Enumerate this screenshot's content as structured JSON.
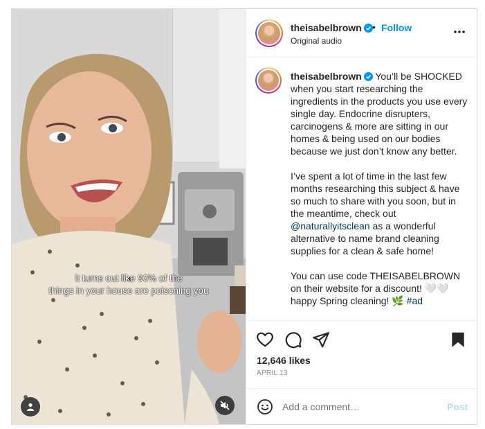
{
  "post": {
    "username": "theisabelbrown",
    "separator": "•",
    "follow_label": "Follow",
    "audio_label": "Original audio",
    "caption": {
      "username": "theisabelbrown",
      "paragraph1": "You’ll be SHOCKED when you start researching the ingredients in the products you use every single day. Endocrine disrupters, carcinogens & more are sitting in our homes & being used on our bodies because we just don’t know any better.",
      "paragraph2_before": "I’ve spent a lot of time in the last few months researching this subject & have so much to share with you soon, but in the meantime, check out",
      "mention": "@naturallyitsclean",
      "paragraph2_after": "as a wonderful alternative to name brand cleaning supplies for a clean & safe home!",
      "paragraph3": "You can use code THEISABELBROWN on their website for a discount! 🤍🤍 happy Spring cleaning! 🌿",
      "hashtag": "#ad"
    },
    "video_overlay": {
      "line1": "it turns out like 90% of the",
      "line2": "things in your house are poisoning you"
    },
    "likes": "12,646 likes",
    "date": "APRIL 13",
    "comment_placeholder": "Add a comment…",
    "post_label": "Post"
  },
  "icons": {
    "verified": "verified-badge-icon",
    "more": "more-options-icon",
    "like": "heart-icon",
    "comment": "comment-bubble-icon",
    "share": "paper-plane-icon",
    "save": "bookmark-icon",
    "emoji": "emoji-icon",
    "user_tag": "user-tag-icon",
    "mute": "speaker-muted-icon"
  },
  "colors": {
    "follow": "#0095f6",
    "verified": "#0095f6",
    "post_disabled": "#b2dffc",
    "muted_text": "#8e8e8e",
    "mention": "#00376b"
  }
}
